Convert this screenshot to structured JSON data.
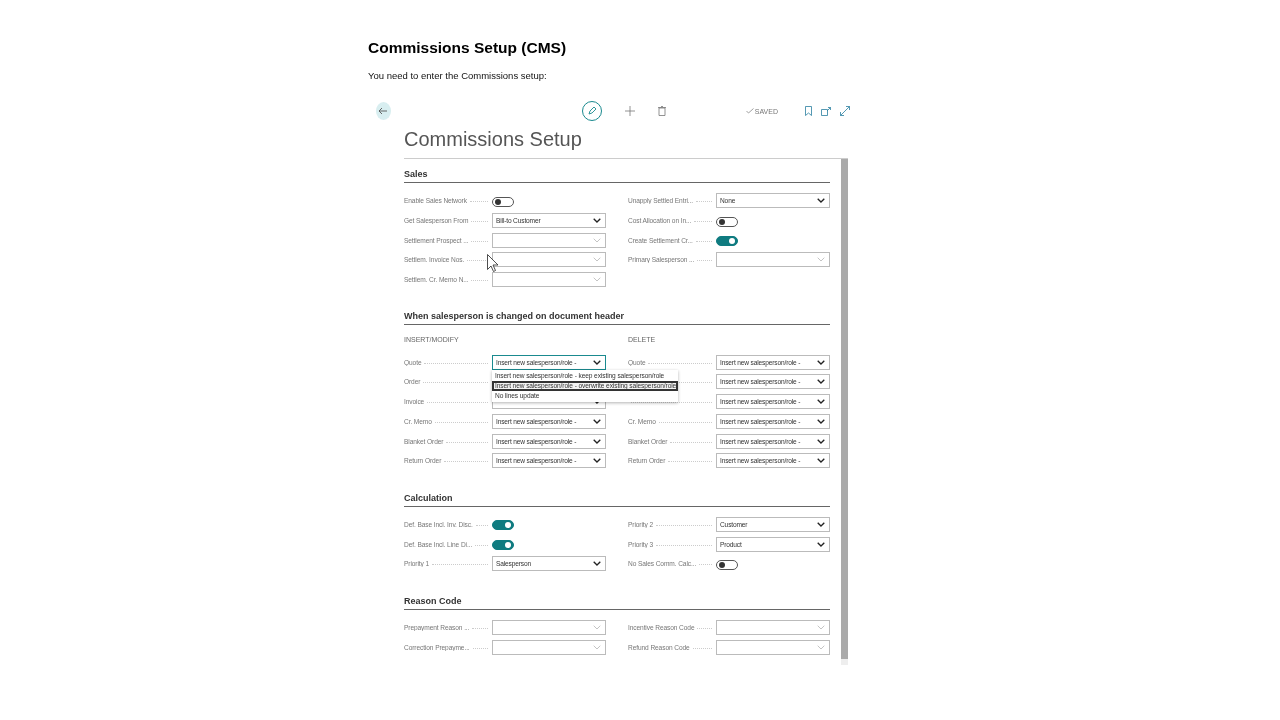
{
  "page": {
    "title": "Commissions Setup (CMS)",
    "intro": "You need to enter the Commissions setup:"
  },
  "toolbar": {
    "status": "SAVED"
  },
  "card": {
    "title": "Commissions Setup"
  },
  "sections": [
    {
      "title": "Sales",
      "columns": [
        {
          "fields": [
            {
              "label": "Enable Sales Network",
              "kind": "toggle",
              "on": false
            },
            {
              "label": "Get Salesperson From",
              "kind": "select",
              "value": "Bill-to Customer"
            },
            {
              "label": "Settlement Prospect ...",
              "kind": "lookup"
            },
            {
              "label": "Settlem. Invoice Nos.",
              "kind": "lookup"
            },
            {
              "label": "Settlem. Cr. Memo N...",
              "kind": "lookup"
            }
          ]
        },
        {
          "fields": [
            {
              "label": "Unapply Settled Entri...",
              "kind": "select",
              "value": "None"
            },
            {
              "label": "Cost Allocation on In...",
              "kind": "toggle",
              "on": false
            },
            {
              "label": "Create Settlement Cr...",
              "kind": "toggle",
              "on": true
            },
            {
              "label": "Primary Salesperson ...",
              "kind": "lookup"
            }
          ]
        }
      ]
    },
    {
      "title": "When salesperson is changed on document header",
      "columns": [
        {
          "heading": "INSERT/MODIFY",
          "fields": [
            {
              "label": "Quote",
              "kind": "select",
              "value": "Insert new salesperson/role -",
              "dropdown": [
                {
                  "label": "Insert new salesperson/role - keep existing salesperson/role",
                  "selected": false
                },
                {
                  "label": "Insert new salesperson/role - overwrite existing salesperson/role",
                  "selected": true
                },
                {
                  "label": "No lines update",
                  "selected": false
                }
              ]
            },
            {
              "label": "Order",
              "kind": "select"
            },
            {
              "label": "Invoice",
              "kind": "select"
            },
            {
              "label": "Cr. Memo",
              "kind": "select",
              "value": "Insert new salesperson/role -"
            },
            {
              "label": "Blanket Order",
              "kind": "select",
              "value": "Insert new salesperson/role -"
            },
            {
              "label": "Return Order",
              "kind": "select",
              "value": "Insert new salesperson/role -"
            }
          ]
        },
        {
          "heading": "DELETE",
          "fields": [
            {
              "label": "Quote",
              "kind": "select",
              "value": "Insert new salesperson/role -"
            },
            {
              "kind": "select",
              "value": "Insert new salesperson/role -"
            },
            {
              "kind": "select",
              "value": "Insert new salesperson/role -"
            },
            {
              "label": "Cr. Memo",
              "kind": "select",
              "value": "Insert new salesperson/role -"
            },
            {
              "label": "Blanket Order",
              "kind": "select",
              "value": "Insert new salesperson/role -"
            },
            {
              "label": "Return Order",
              "kind": "select",
              "value": "Insert new salesperson/role -"
            }
          ]
        }
      ]
    },
    {
      "title": "Calculation",
      "columns": [
        {
          "fields": [
            {
              "label": "Def. Base Incl. Inv. Disc.",
              "kind": "toggle",
              "on": true
            },
            {
              "label": "Def. Base Incl. Line Di...",
              "kind": "toggle",
              "on": true
            },
            {
              "label": "Priority 1",
              "kind": "select",
              "value": "Salesperson"
            }
          ]
        },
        {
          "fields": [
            {
              "label": "Priority 2",
              "kind": "select",
              "value": "Customer"
            },
            {
              "label": "Priority 3",
              "kind": "select",
              "value": "Product"
            },
            {
              "label": "No Sales Comm. Calc...",
              "kind": "toggle",
              "on": false
            }
          ]
        }
      ]
    },
    {
      "title": "Reason Code",
      "columns": [
        {
          "fields": [
            {
              "label": "Prepayment Reason ...",
              "kind": "lookup"
            },
            {
              "label": "Correction Prepayme...",
              "kind": "lookup"
            }
          ]
        },
        {
          "fields": [
            {
              "label": "Incentive Reason Code",
              "kind": "lookup"
            },
            {
              "label": "Refund Reason Code",
              "kind": "lookup"
            }
          ]
        }
      ]
    }
  ]
}
